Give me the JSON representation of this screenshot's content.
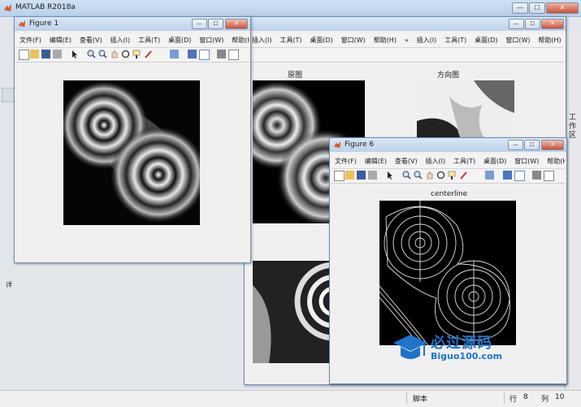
{
  "app": {
    "title": "MATLAB R2018a"
  },
  "main_window_buttons": {
    "minimize": "—",
    "maximize": "☐",
    "close": "✕"
  },
  "figure_buttons": {
    "minimize": "—",
    "maximize": "☐",
    "close": "✕"
  },
  "menu": [
    "文件(F)",
    "编辑(E)",
    "查看(V)",
    "插入(I)",
    "工具(T)",
    "桌面(D)",
    "窗口(W)",
    "帮助(H)"
  ],
  "menu_overflow": "»",
  "figures": {
    "fig1": {
      "title": "Figure 1"
    },
    "fig6": {
      "title": "Figure 6",
      "axes_title": "centerline"
    },
    "background": {
      "original_title": "原图",
      "orientation_title": "方向图"
    }
  },
  "sidebar": {
    "tab_label": "工作区"
  },
  "left_gutter": {
    "label": "详"
  },
  "statusbar": {
    "mode": "脚本",
    "row_label": "行",
    "row_value": "8",
    "col_label": "列",
    "col_value": "10"
  },
  "watermark": {
    "text": "必过源码",
    "subtext": "Biguo100.com"
  },
  "colors": {
    "titlebar": "#c4d8ee",
    "plot_bg": "#000000",
    "watermark": "#1f73c9"
  },
  "icons": [
    "new-file-icon",
    "open-folder-icon",
    "save-icon",
    "print-icon",
    "pointer-icon",
    "zoom-in-icon",
    "zoom-out-icon",
    "pan-icon",
    "rotate-icon",
    "datatip-icon",
    "brush-icon",
    "link-icon",
    "colorbar-icon",
    "legend-icon",
    "hide-icon",
    "show-icon"
  ]
}
